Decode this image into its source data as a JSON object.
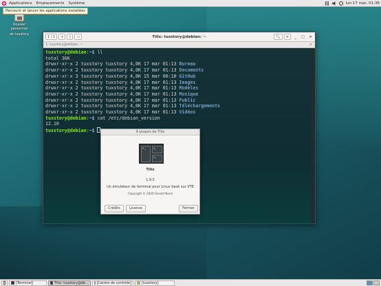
{
  "top_panel": {
    "menus": [
      "Applications",
      "Emplacements",
      "Système"
    ],
    "clock": "lun 17 mar, 01:36",
    "tray_icons": [
      "network-icon",
      "volume-icon",
      "power-icon"
    ]
  },
  "tooltip": "Parcourir et lancer les applications installées",
  "desktop_icon": {
    "label_line1": "Dossier personnel",
    "label_line2": "de tuxstory"
  },
  "terminal": {
    "title": "Tilix: tuxstory@debian: ~",
    "session_btn": "1 / 1",
    "tab_label": "1: tuxstory@debian: ~",
    "prompt_user": "tuxstory@debian",
    "prompt_path": ":~$",
    "cmd1": " ll",
    "total": "total 36K",
    "listing": [
      {
        "perm": "drwxr-xr-x 2 tuxstory tuxstory 4,0K 17 mar 01:13 ",
        "name": "Bureau"
      },
      {
        "perm": "drwxr-xr-x 2 tuxstory tuxstory 4,0K 17 mar 01:13 ",
        "name": "Documents"
      },
      {
        "perm": "drwxr-xr-x 3 tuxstory tuxstory 4,0K 15 mar 00:10 ",
        "name": "GitHub"
      },
      {
        "perm": "drwxr-xr-x 2 tuxstory tuxstory 4,0K 17 mar 01:13 ",
        "name": "Images"
      },
      {
        "perm": "drwxr-xr-x 2 tuxstory tuxstory 4,0K 17 mar 01:13 ",
        "name": "Modèles"
      },
      {
        "perm": "drwxr-xr-x 2 tuxstory tuxstory 4,0K 17 mar 01:13 ",
        "name": "Musique"
      },
      {
        "perm": "drwxr-xr-x 2 tuxstory tuxstory 4,0K 17 mar 01:13 ",
        "name": "Public"
      },
      {
        "perm": "drwxr-xr-x 2 tuxstory tuxstory 4,0K 17 mar 01:13 ",
        "name": "Téléchargements"
      },
      {
        "perm": "drwxr-xr-x 2 tuxstory tuxstory 4,0K 17 mar 01:13 ",
        "name": "Vidéos"
      }
    ],
    "cmd2": " cat /etc/debian_version",
    "output2": "12.10"
  },
  "about": {
    "title": "À propos de Tilix",
    "app_name": "Tilix",
    "version": "1.9.5",
    "description": "Un émulateur de terminal pour Linux basé sur VTE",
    "copyright": "Copyright © 2020 Gerald Nunn",
    "btn_credits": "Crédits",
    "btn_licence": "Licence",
    "btn_close": "Fermer"
  },
  "taskbar": {
    "items": [
      {
        "label": "[Terminal]",
        "active": false
      },
      {
        "label": "Tilix: tuxstory@de...",
        "active": true
      },
      {
        "label": "[Centre de contrôle]",
        "active": false
      },
      {
        "label": "[tuxstory]",
        "active": false
      }
    ]
  },
  "colors": {
    "prompt_user": "#8ae234",
    "directory": "#729fcf",
    "terminal_bg": "#142b30",
    "desktop": "#1f6672"
  }
}
